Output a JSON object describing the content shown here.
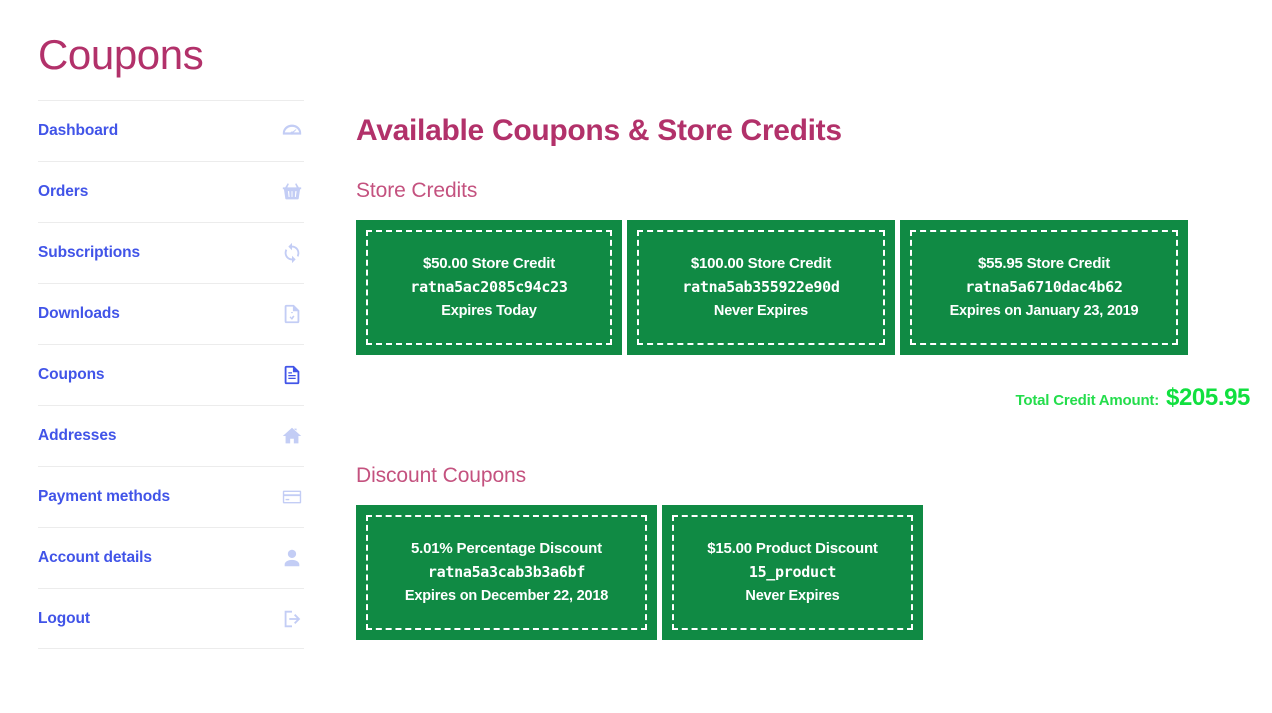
{
  "sidebar": {
    "title": "Coupons",
    "items": [
      {
        "label": "Dashboard",
        "icon": "dashboard-gauge-icon",
        "active": false
      },
      {
        "label": "Orders",
        "icon": "shopping-basket-icon",
        "active": false
      },
      {
        "label": "Subscriptions",
        "icon": "refresh-sync-icon",
        "active": false
      },
      {
        "label": "Downloads",
        "icon": "download-file-icon",
        "active": false
      },
      {
        "label": "Coupons",
        "icon": "document-icon",
        "active": true
      },
      {
        "label": "Addresses",
        "icon": "home-icon",
        "active": false
      },
      {
        "label": "Payment methods",
        "icon": "credit-card-icon",
        "active": false
      },
      {
        "label": "Account details",
        "icon": "user-icon",
        "active": false
      },
      {
        "label": "Logout",
        "icon": "sign-out-icon",
        "active": false
      }
    ]
  },
  "main": {
    "heading": "Available Coupons & Store Credits",
    "store_credits": {
      "section_label": "Store Credits",
      "cards": [
        {
          "amount": "$50.00 Store Credit",
          "code": "ratna5ac2085c94c23",
          "expiry": "Expires Today"
        },
        {
          "amount": "$100.00 Store Credit",
          "code": "ratna5ab355922e90d",
          "expiry": "Never Expires"
        },
        {
          "amount": "$55.95 Store Credit",
          "code": "ratna5a6710dac4b62",
          "expiry": "Expires on January 23, 2019"
        }
      ],
      "total_label": "Total Credit Amount:",
      "total_amount": "$205.95"
    },
    "discount_coupons": {
      "section_label": "Discount Coupons",
      "cards": [
        {
          "amount": "5.01% Percentage Discount",
          "code": "ratna5a3cab3b3a6bf",
          "expiry": "Expires on December 22, 2018"
        },
        {
          "amount": "$15.00 Product Discount",
          "code": "15_product",
          "expiry": "Never Expires"
        }
      ]
    }
  },
  "colors": {
    "brand_crimson": "#b2316a",
    "section_crimson": "#c4527f",
    "nav_blue": "#4154e8",
    "nav_icon_muted": "#c3cdf5",
    "coupon_green": "#108a44",
    "total_green": "#11e03f",
    "divider": "#ececec"
  }
}
